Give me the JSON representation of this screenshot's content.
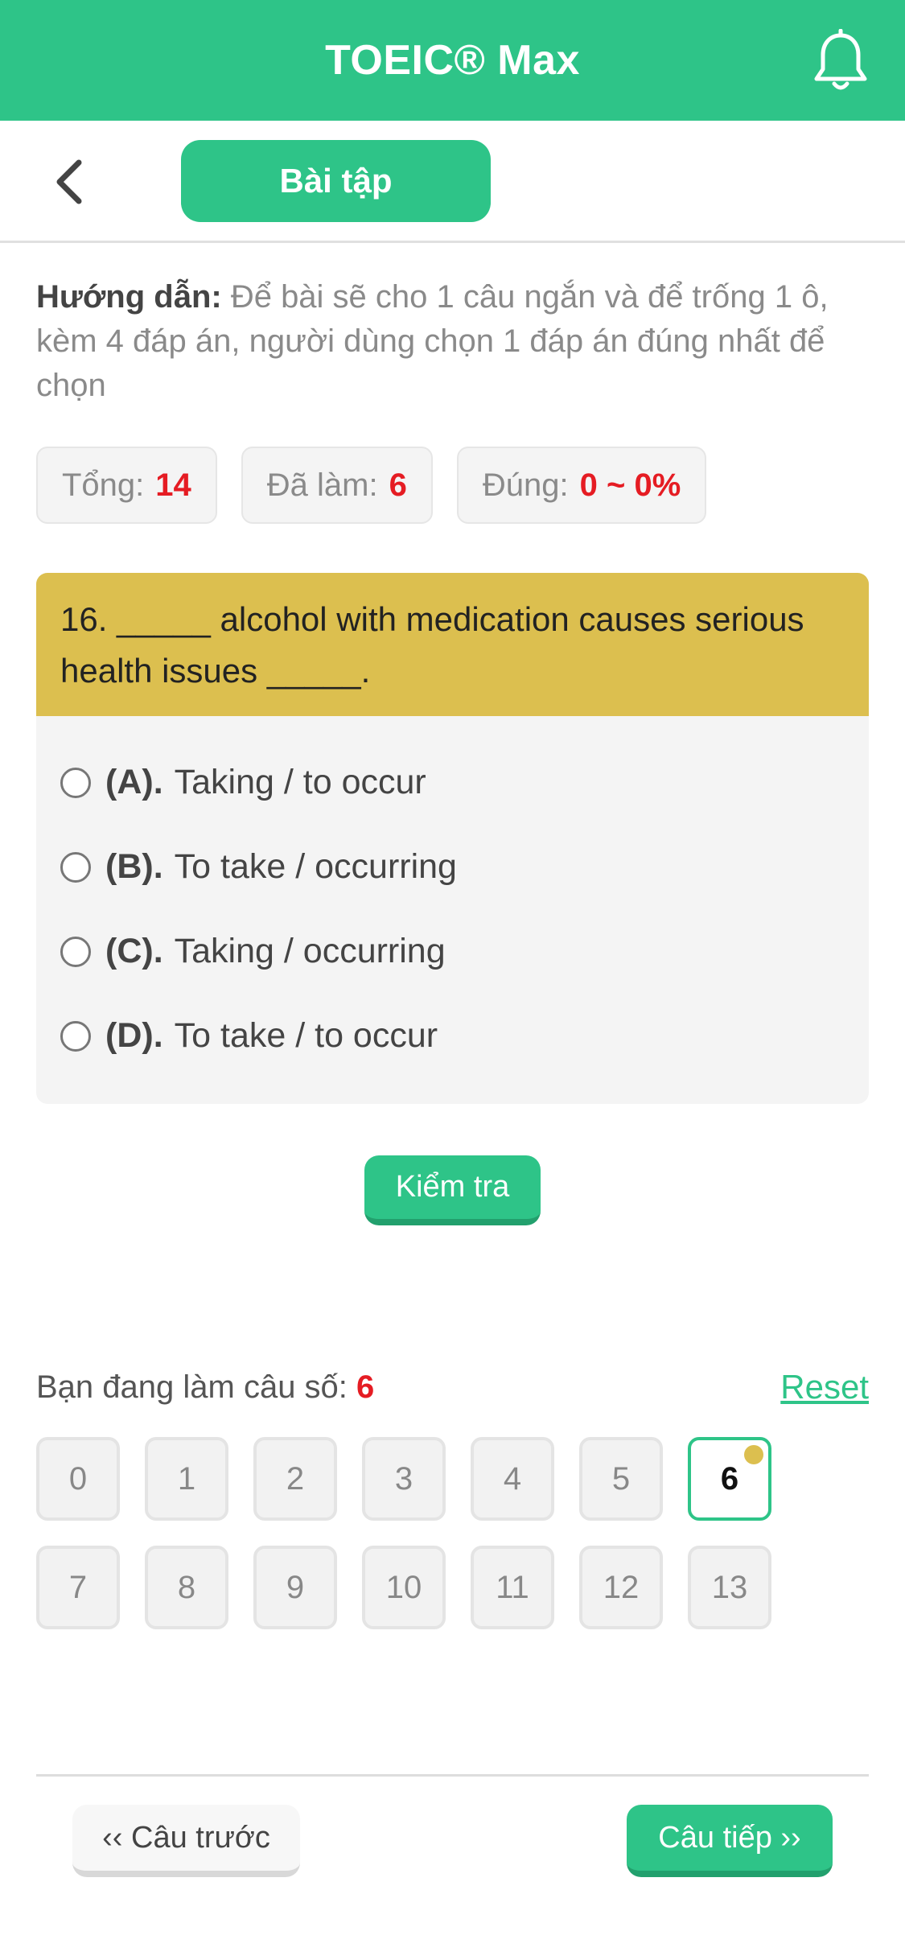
{
  "header": {
    "title": "TOEIC® Max",
    "bell_icon": "bell-icon"
  },
  "nav": {
    "back_icon": "chevron-left-icon",
    "tab_label": "Bài tập"
  },
  "instructions": {
    "label": "Hướng dẫn:",
    "text": " Để bài sẽ cho 1 câu ngắn và để trống 1 ô, kèm 4 đáp án, người dùng chọn 1 đáp án đúng nhất để chọn"
  },
  "stats": [
    {
      "label": "Tổng:",
      "value": "14"
    },
    {
      "label": "Đã làm:",
      "value": "6"
    },
    {
      "label": "Đúng:",
      "value": "0 ~ 0%"
    }
  ],
  "question": {
    "text": "16. _____ alcohol with medication causes serious health issues _____.",
    "options": [
      {
        "letter": "(A).",
        "text": "Taking / to occur"
      },
      {
        "letter": "(B).",
        "text": "To take / occurring"
      },
      {
        "letter": "(C).",
        "text": "Taking / occurring"
      },
      {
        "letter": "(D).",
        "text": "To take / to occur"
      }
    ]
  },
  "check_button": "Kiểm tra",
  "progress": {
    "label": "Bạn đang làm câu số:",
    "current": "6",
    "reset": "Reset"
  },
  "grid": [
    "0",
    "1",
    "2",
    "3",
    "4",
    "5",
    "6",
    "7",
    "8",
    "9",
    "10",
    "11",
    "12",
    "13"
  ],
  "active_index": 6,
  "footer": {
    "prev": "‹‹ Câu trước",
    "next": "Câu tiếp ››"
  },
  "colors": {
    "primary": "#2ec488",
    "question_bg": "#dcbf4f",
    "highlight": "#e51c23"
  }
}
